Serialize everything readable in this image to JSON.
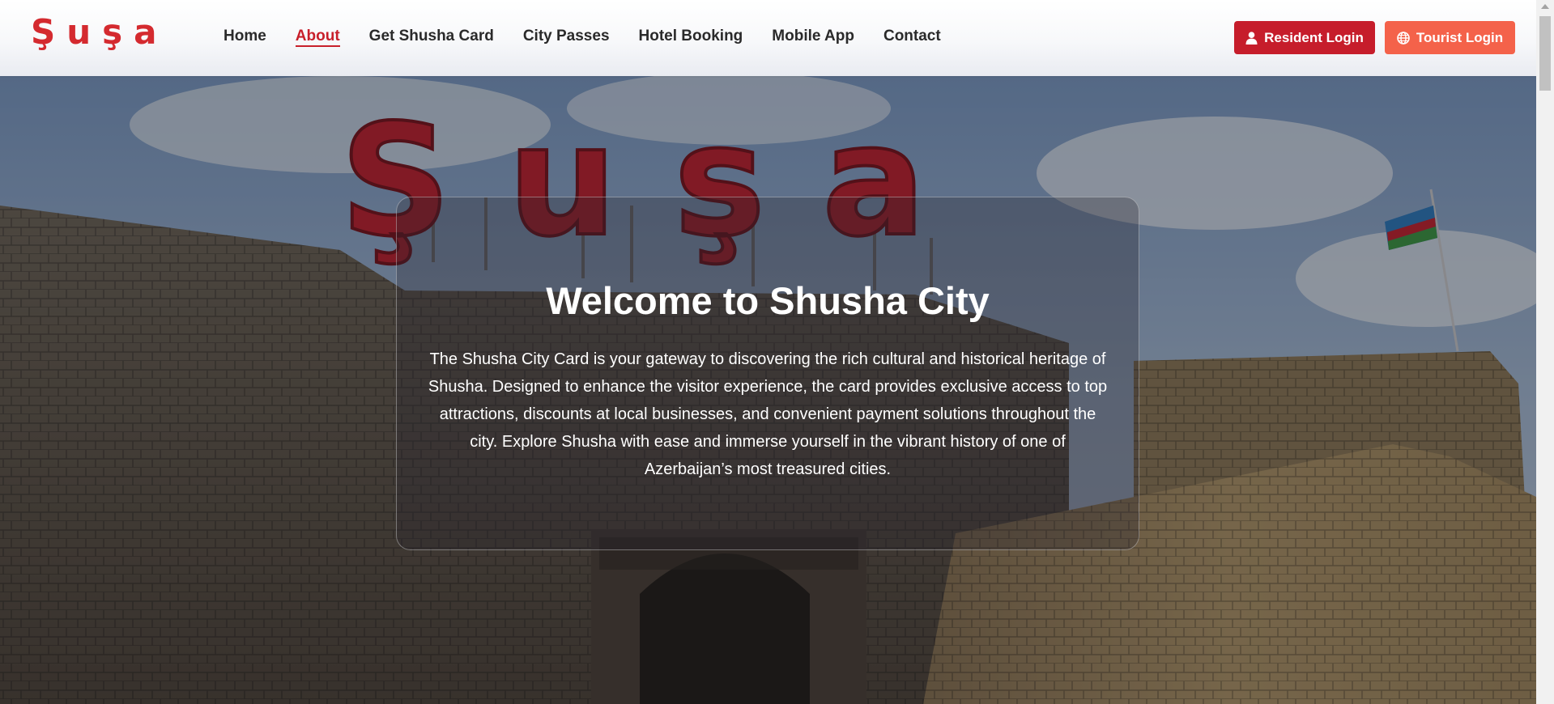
{
  "brand": {
    "logo_text": "Şuşa",
    "accent_color": "#c8202b"
  },
  "nav": {
    "items": [
      {
        "label": "Home",
        "active": false
      },
      {
        "label": "About",
        "active": true
      },
      {
        "label": "Get Shusha Card",
        "active": false
      },
      {
        "label": "City Passes",
        "active": false
      },
      {
        "label": "Hotel Booking",
        "active": false
      },
      {
        "label": "Mobile App",
        "active": false
      },
      {
        "label": "Contact",
        "active": false
      }
    ]
  },
  "auth": {
    "resident_label": "Resident Login",
    "resident_icon": "user-icon",
    "resident_color": "#c61d2b",
    "tourist_label": "Tourist Login",
    "tourist_icon": "globe-icon",
    "tourist_color": "#f4624a"
  },
  "hero": {
    "sign_text": "Şuşa",
    "title": "Welcome to Shusha City",
    "body": "The Shusha City Card is your gateway to discovering the rich cultural and historical heritage of Shusha. Designed to enhance the visitor experience, the card provides exclusive access to top attractions, discounts at local businesses, and convenient payment solutions throughout the city. Explore Shusha with ease and immerse yourself in the vibrant history of one of Azerbaijan’s most treasured cities."
  }
}
